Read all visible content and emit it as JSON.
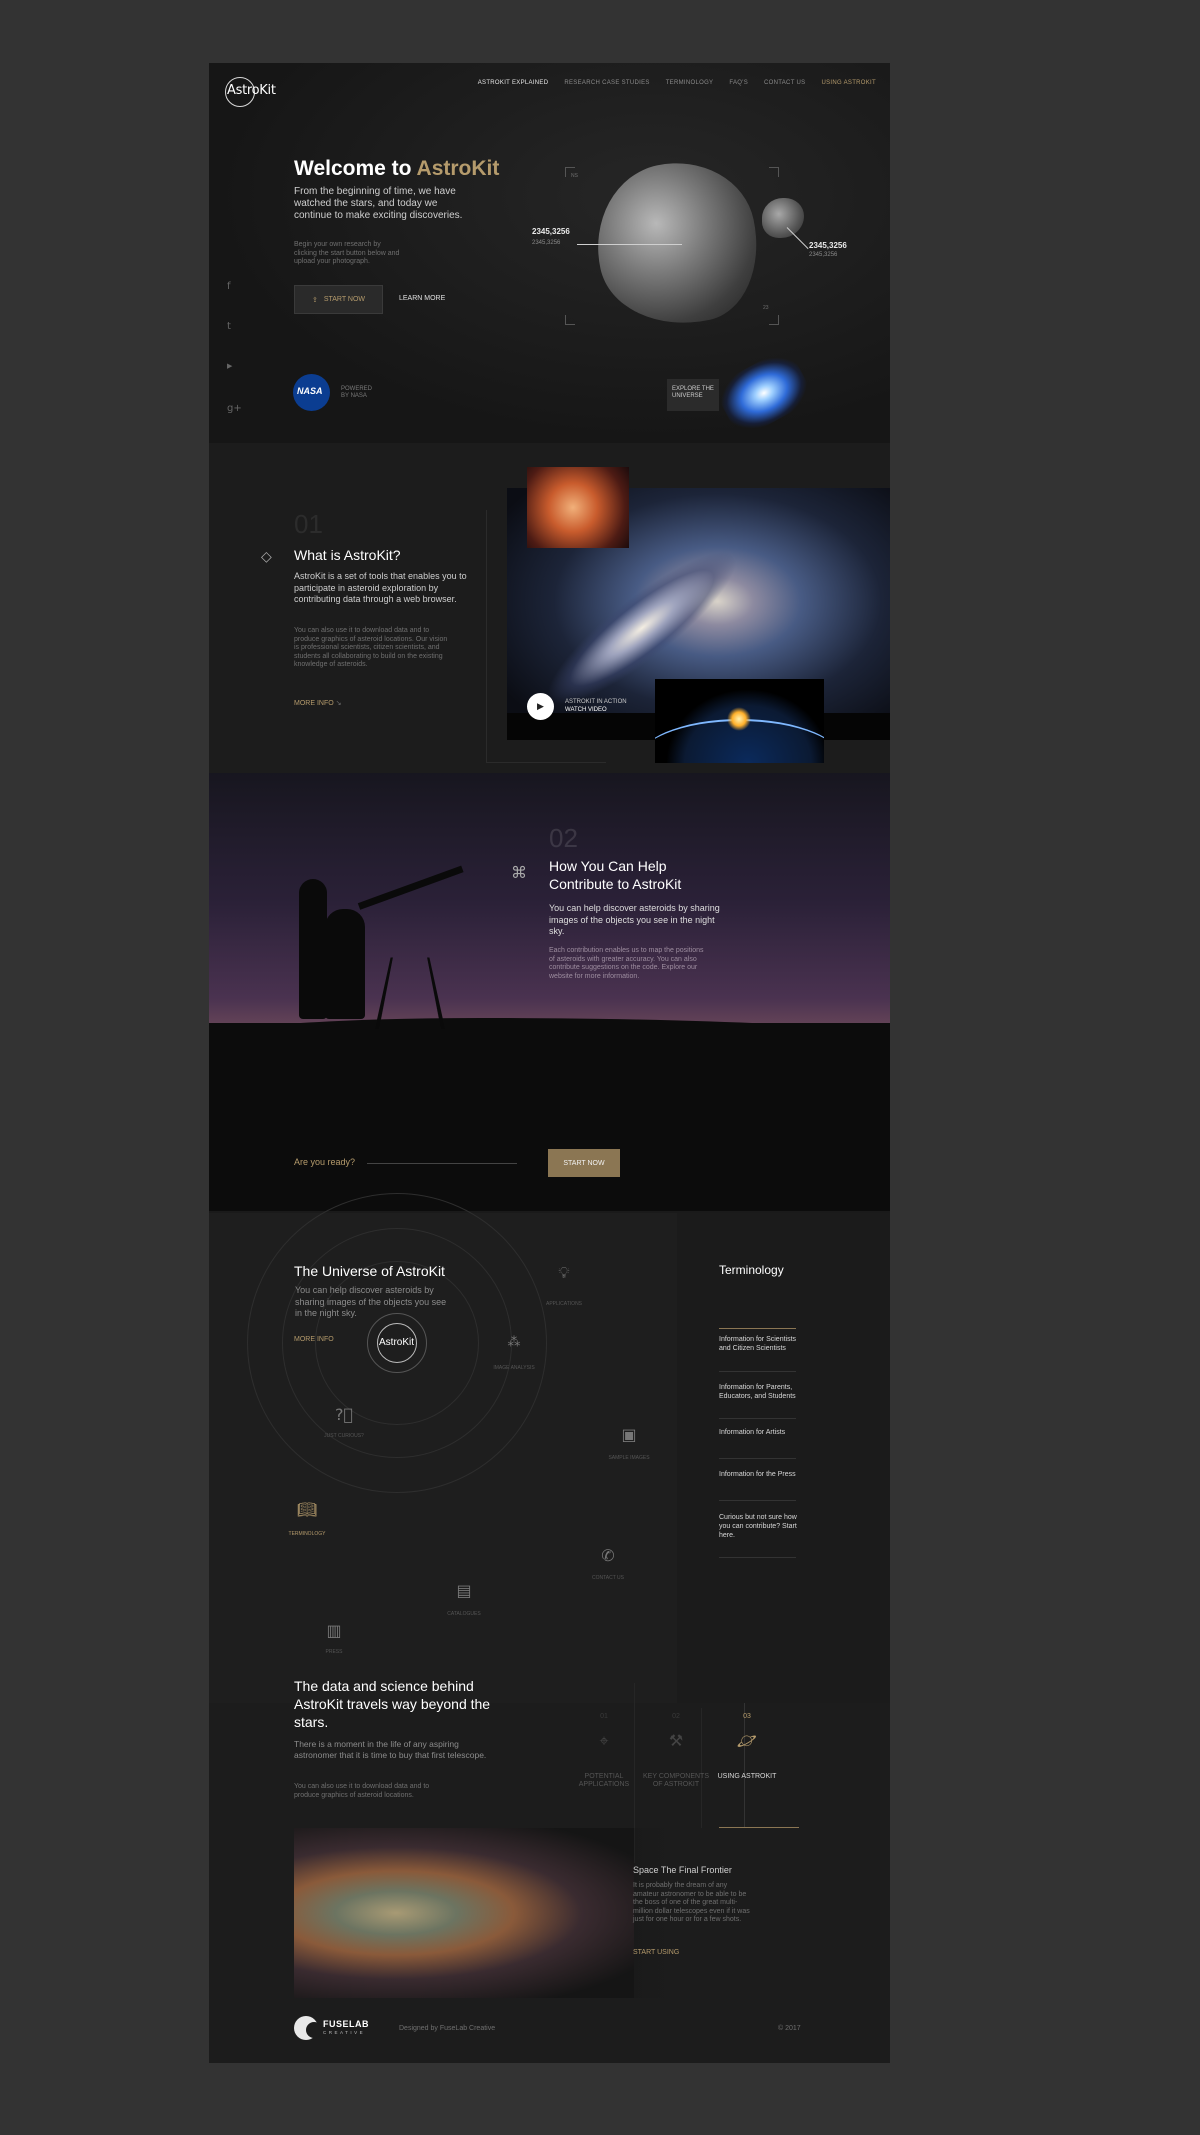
{
  "nav": {
    "logo": "AstroKit",
    "items": [
      "ASTROKIT EXPLAINED",
      "RESEARCH CASE STUDIES",
      "TERMINOLOGY",
      "FAQ'S",
      "CONTACT US",
      "USING ASTROKIT"
    ]
  },
  "hero": {
    "title_prefix": "Welcome to ",
    "title_brand": "AstroKit",
    "lead": "From the beginning of time, we have watched the stars, and today we continue to make exciting discoveries.",
    "sub": "Begin your own research by clicking the start button below and upload your photograph.",
    "start_label": "START NOW",
    "learn_label": "LEARN MORE",
    "coord_left": "2345,3256",
    "coord_left_sub": "2345,3256",
    "coord_right": "2345,3256",
    "coord_right_sub": "2345,3256",
    "corner_top": "NS",
    "corner_bottom": "23",
    "powered": "POWERED BY NASA",
    "nasa": "NASA",
    "explore": "EXPLORE THE UNIVERSE"
  },
  "social": {
    "f": "f",
    "t": "t",
    "y": "▶",
    "g": "g+"
  },
  "what": {
    "num": "01",
    "title": "What is AstroKit?",
    "lead": "AstroKit is a set of tools that enables you to participate in asteroid exploration by contributing data through a web browser.",
    "body": "You can also use it to download data and to produce graphics of asteroid locations. Our vision is professional scientists, citizen scientists, and students all collaborating to build on the existing knowledge of asteroids.",
    "more": "MORE INFO",
    "video_line1": "ASTROKIT IN ACTION",
    "video_line2": "WATCH VIDEO"
  },
  "help": {
    "num": "02",
    "title_1": "How You Can Help",
    "title_2": "Contribute to AstroKit",
    "lead": "You can help discover asteroids by sharing images of the objects you see in the night sky.",
    "body": "Each contribution enables us to map the positions of asteroids with greater accuracy. You can also contribute suggestions on the code. Explore our website for more information.",
    "cta_text": "Are you ready?",
    "cta_btn": "START NOW"
  },
  "universe": {
    "title": "The Universe of AstroKit",
    "lead": "You can help discover asteroids by sharing images of the objects you see in the night sky.",
    "more": "MORE INFO",
    "center": "AstroKit",
    "nodes": {
      "applications": "APPLICATIONS",
      "image_analysis": "IMAGE ANALYSIS",
      "just_curious": "JUST CURIOUS?",
      "sample_images": "SAMPLE IMAGES",
      "terminology": "TERMINOLOGY",
      "contact": "CONTACT US",
      "catalogues": "CATALOGUES",
      "press": "PRESS"
    }
  },
  "terminology": {
    "title": "Terminology",
    "items": [
      "Information for Scientists and Citizen Scientists",
      "Information for Parents, Educators, and Students",
      "Information for Artists",
      "Information for the Press",
      "Curious but not sure how you can contribute? Start here."
    ]
  },
  "data": {
    "title": "The data and science behind AstroKit travels way beyond the stars.",
    "lead": "There is a moment in the life of any aspiring astronomer that it is time to buy that first telescope.",
    "body": "You can also use it to download data and to produce graphics of asteroid locations.",
    "tabs": [
      {
        "num": "01",
        "label": "POTENTIAL APPLICATIONS"
      },
      {
        "num": "02",
        "label": "KEY COMPONENTS OF ASTROKIT"
      },
      {
        "num": "03",
        "label": "USING ASTROKIT"
      }
    ],
    "card_title": "Space The Final Frontier",
    "card_body": "It is probably the dream of any amateur astronomer to be able to be the boss of one of the great multi-million dollar telescopes even if it was just for one hour or for a few shots.",
    "card_link": "START USING"
  },
  "footer": {
    "brand": "FUSELAB",
    "brand_sub": "CREATIVE",
    "designed": "Designed by FuseLab Creative",
    "copyright": "© 2017"
  }
}
